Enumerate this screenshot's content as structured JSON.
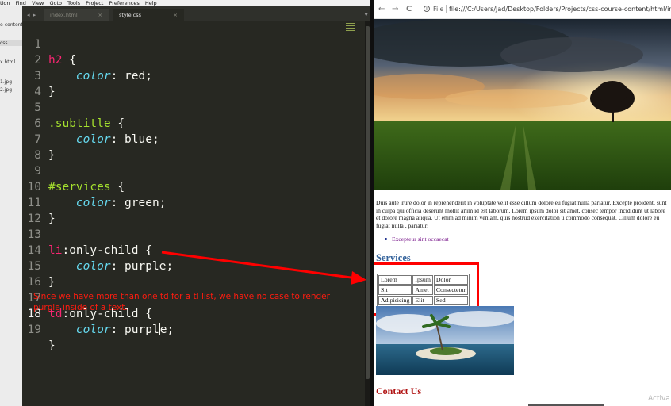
{
  "editor": {
    "menu": [
      "tion",
      "Find",
      "View",
      "Goto",
      "Tools",
      "Project",
      "Preferences",
      "Help"
    ],
    "sidebar_items": [
      "e-content",
      "css",
      "x.html",
      "1.jpg",
      "2.jpg"
    ],
    "tabs": [
      {
        "label": "index.html",
        "close": "×"
      },
      {
        "label": "style.css",
        "close": "×"
      }
    ],
    "nav_arrows": "◂ ▸",
    "tab_dropdown": "▼",
    "annotation": "Since we have more than one td for a tl list, we have no case to render purple inside of a text.",
    "code_tokens": {
      "h2": "h2",
      "subtitle": ".subtitle",
      "services": "#services",
      "li": "li",
      "td": "td",
      "only_child": ":only-child",
      "color": "color",
      "red": "red",
      "blue": "blue",
      "green": "green",
      "purple": "purple",
      "purp": "purpl",
      "le": "e"
    },
    "line_numbers": [
      "1",
      "2",
      "3",
      "4",
      "5",
      "6",
      "7",
      "8",
      "9",
      "10",
      "11",
      "12",
      "13",
      "14",
      "15",
      "16",
      "17",
      "18",
      "19"
    ]
  },
  "browser": {
    "back": "←",
    "forward": "→",
    "reload": "C",
    "info": "i",
    "file_label": "File",
    "url": "file:///C:/Users/Jad/Desktop/Folders/Projects/css-course-content/html/index.html",
    "paragraph": "Duis aute irure dolor in reprehenderit in voluptate velit esse cillum dolore eu fugiat nulla pariatur. Excepte proident, sunt in culpa qui officia deserunt mollit anim id est laborum. Lorem ipsum dolor sit amet, consec tempor incididunt ut labore et dolore magna aliqua. Ut enim ad minim veniam, quis nostrud exercitation u commodo consequat. Cillum dolore eu fugiat nulla , pariatur:",
    "list_items": [
      "Excepteur sint occaecat"
    ],
    "services_heading": "Services",
    "table": [
      [
        "Lorem",
        "Ipsum",
        "Dolor"
      ],
      [
        "Sit",
        "Amet",
        "Consectetur"
      ],
      [
        "Adipisicing",
        "Elit",
        "Sed"
      ]
    ],
    "contact_heading": "Contact Us",
    "watermark": "Activa"
  },
  "colors": {
    "editor_bg": "#272822",
    "keyword_pink": "#f92672",
    "green": "#a6e22e",
    "property_cyan": "#66d9ef",
    "annotation_red": "#ff1c10",
    "services_blue": "#36649c",
    "contact_red": "#b01212"
  }
}
